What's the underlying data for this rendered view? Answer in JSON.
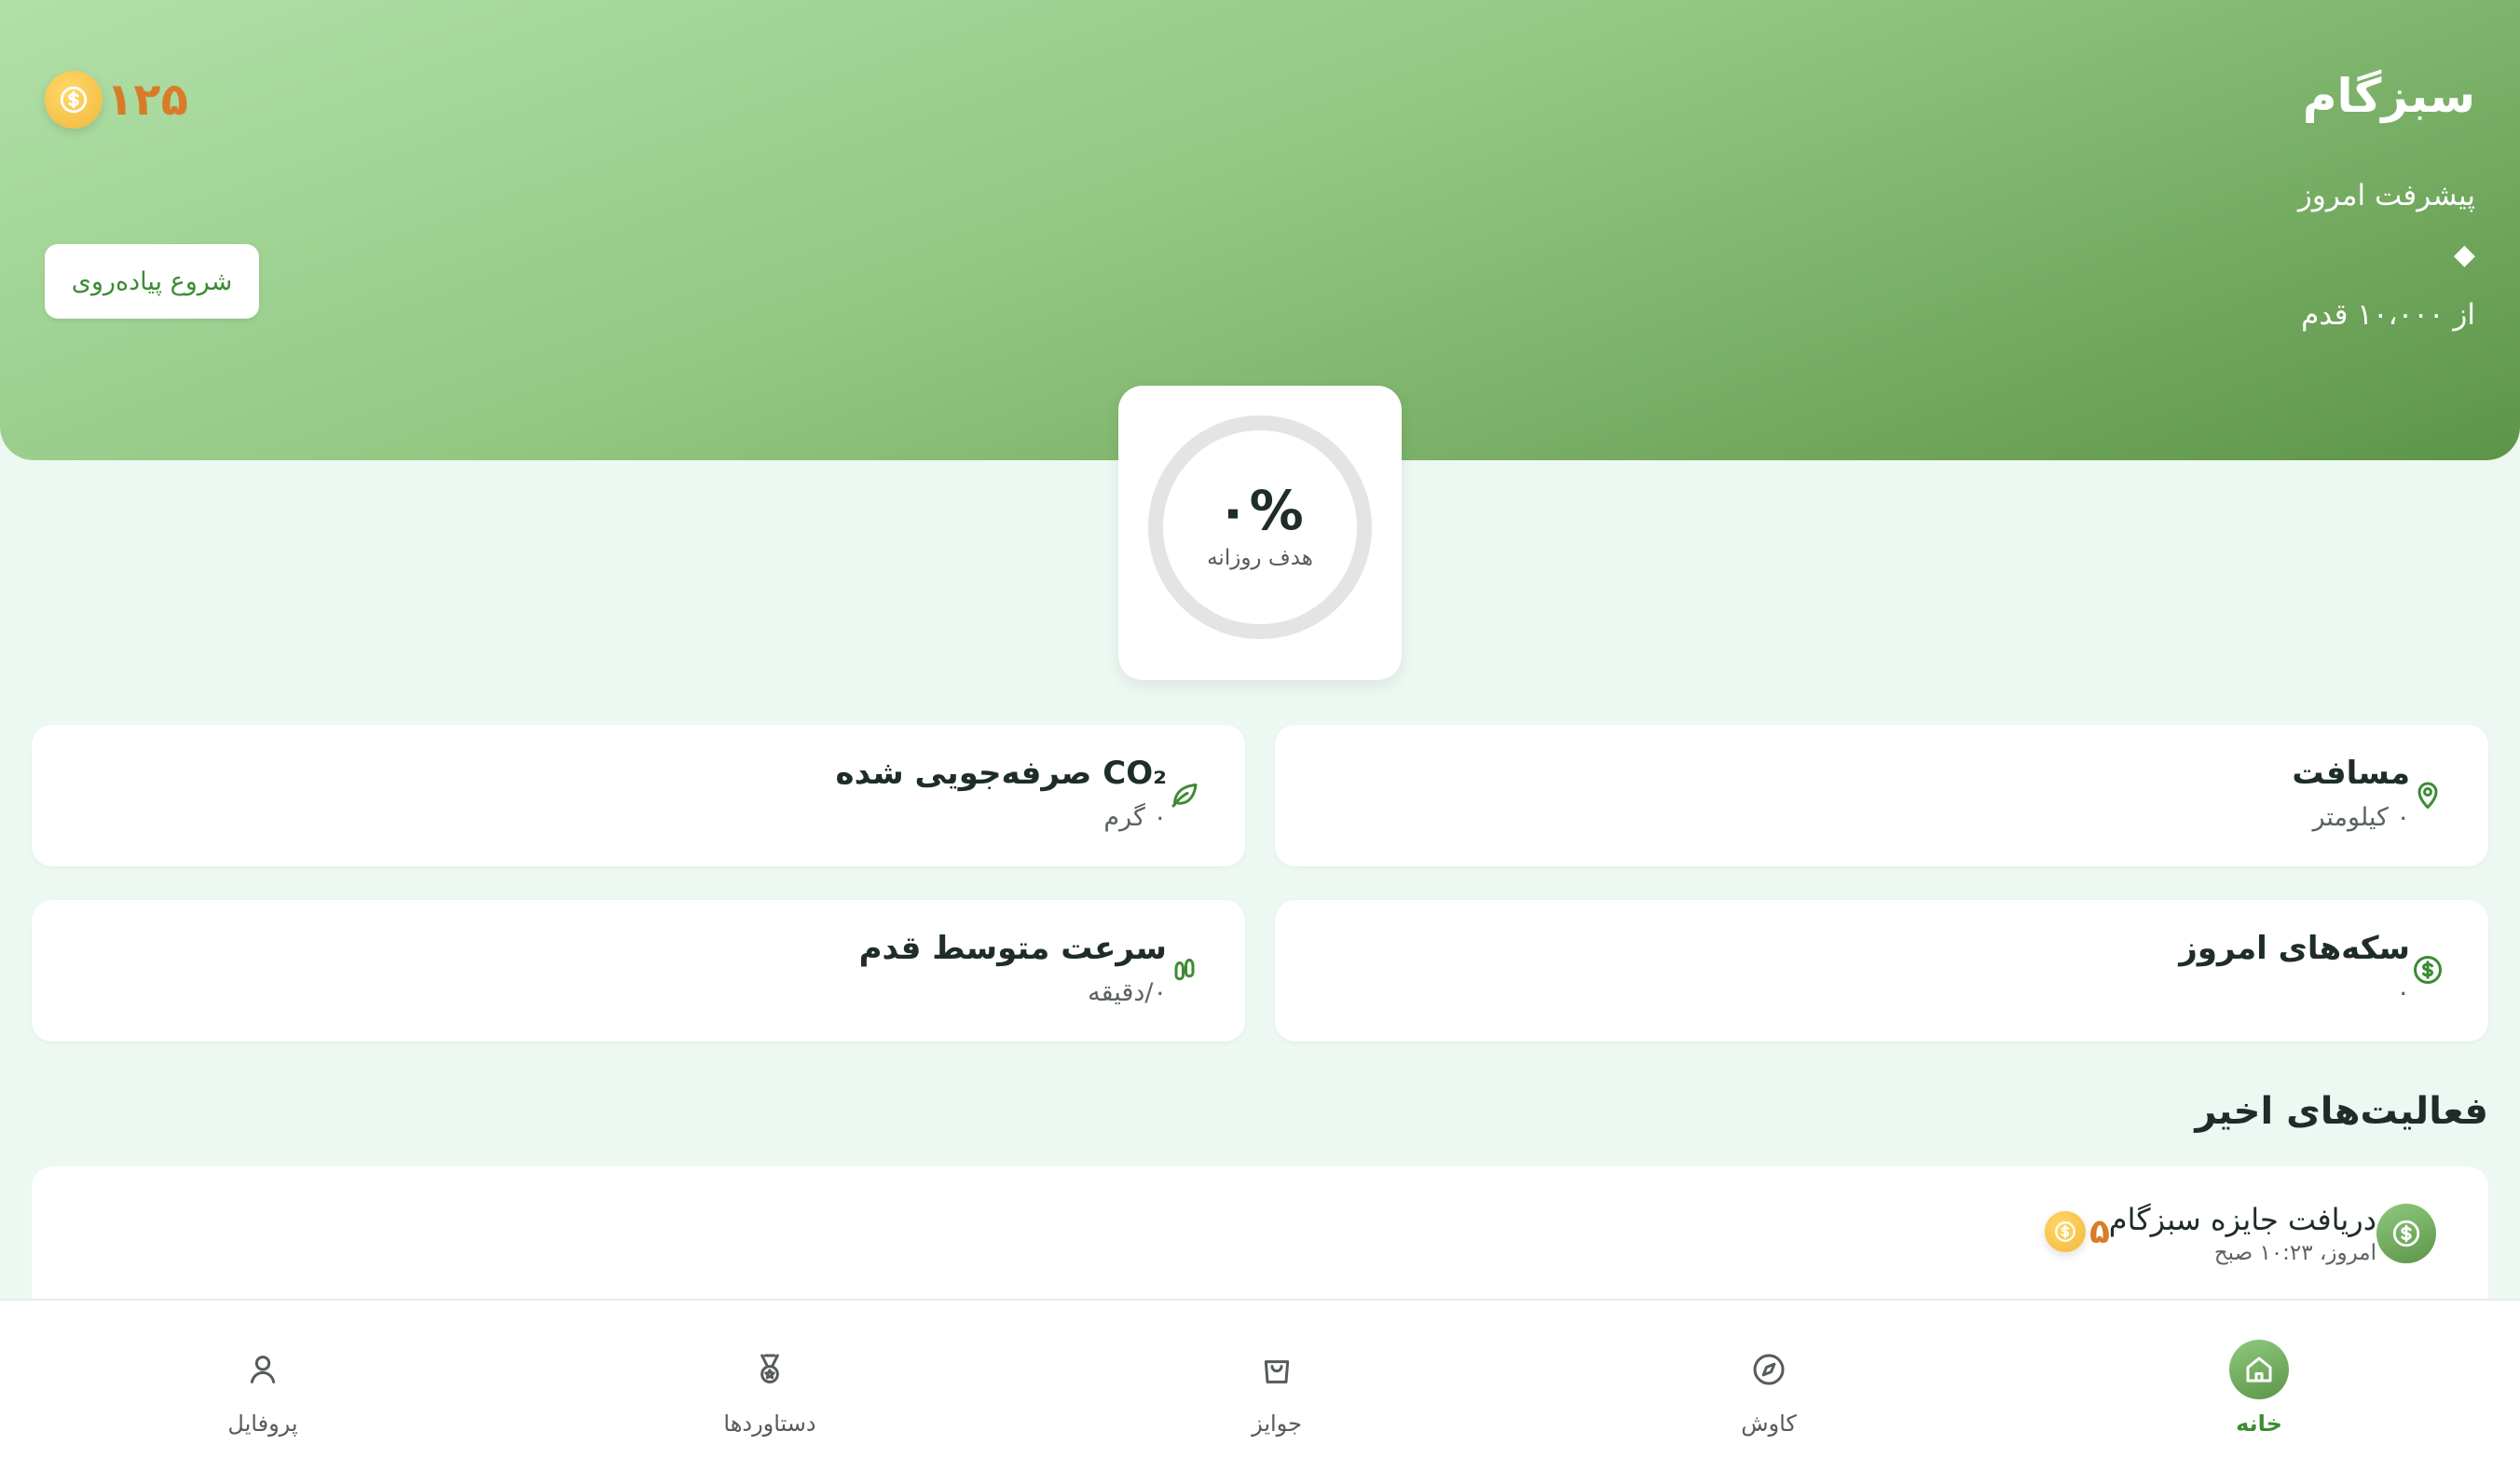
{
  "header": {
    "title": "سبزگام",
    "today_label": "پیشرفت امروز",
    "steps_value": "◆",
    "steps_goal": "از ۱۰،۰۰۰ قدم",
    "coins": "۱۲۵",
    "start_button": "شروع پیاده‌روی"
  },
  "progress": {
    "percent": "۰%",
    "label": "هدف روزانه",
    "ratio": 0
  },
  "stats": {
    "distance": {
      "title": "مسافت",
      "value": "۰ کیلومتر",
      "icon": "location-pin-icon"
    },
    "co2": {
      "title": "CO₂ صرفه‌جویی شده",
      "value": "۰ گرم",
      "icon": "leaf-icon"
    },
    "coins_today": {
      "title": "سکه‌های امروز",
      "value": "۰",
      "icon": "dollar-coin-icon"
    },
    "pace": {
      "title": "سرعت متوسط قدم",
      "value": "۰/دقیقه",
      "icon": "footprints-icon"
    }
  },
  "recent": {
    "title": "فعالیت‌های اخیر",
    "items": [
      {
        "title": "دریافت جایزه سبزگام",
        "time": "امروز، ۱۰:۲۳ صبح",
        "reward": "۵"
      }
    ]
  },
  "nav": {
    "items": [
      {
        "label": "خانه",
        "icon": "home-icon",
        "active": true
      },
      {
        "label": "کاوش",
        "icon": "compass-icon",
        "active": false
      },
      {
        "label": "جوایز",
        "icon": "shopping-bag-icon",
        "active": false
      },
      {
        "label": "دستاوردها",
        "icon": "medal-icon",
        "active": false
      },
      {
        "label": "پروفایل",
        "icon": "user-icon",
        "active": false
      }
    ]
  },
  "colors": {
    "accent": "#3c8b33",
    "coin": "#f2b83a",
    "coin_text": "#d97c2a",
    "background": "#ecf8f1"
  }
}
